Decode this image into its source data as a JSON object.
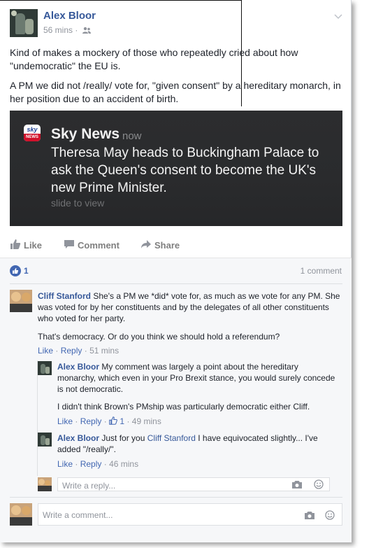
{
  "post": {
    "author": "Alex Bloor",
    "time": "56 mins",
    "audience_icon": "friends-icon",
    "paragraphs": [
      "Kind of makes a mockery of those who repeatedly cried about how \"undemocratic\" the EU is.",
      "A PM we did not /really/ vote for, \"given consent\" by a hereditary monarch, in her position due to an accident of birth."
    ]
  },
  "notification": {
    "logo_top": "sky",
    "logo_bottom": "NEWS",
    "source": "Sky News",
    "time": "now",
    "body": "Theresa May heads to Buckingham Palace to ask the Queen's consent to become the UK's new Prime Minister.",
    "hint": "slide to view"
  },
  "actions": {
    "like": "Like",
    "comment": "Comment",
    "share": "Share"
  },
  "feedback": {
    "like_count": "1",
    "comment_count": "1 comment"
  },
  "comments": [
    {
      "author": "Cliff Stanford",
      "text": "She's a PM we *did* vote for, as much as we vote for any PM. She was voted for by her constituents and by the delegates of all other constituents who voted for her party.",
      "text2": "That's democracy. Or do you think we should hold a referendum?",
      "like": "Like",
      "reply": "Reply",
      "time": "51 mins"
    }
  ],
  "replies": [
    {
      "author": "Alex Bloor",
      "text": "My comment was largely a point about the hereditary monarchy, which even in your Pro Brexit stance, you would surely concede is not democratic.",
      "text2": "I didn't think Brown's PMship was particularly democratic either Cliff.",
      "like": "Like",
      "reply": "Reply",
      "likes": "1",
      "time": "49 mins"
    },
    {
      "author": "Alex Bloor",
      "prefix": "Just for you",
      "mention": "Cliff Stanford",
      "text": "I have equivocated slightly... I've added \"/really/\".",
      "like": "Like",
      "reply": "Reply",
      "time": "46 mins"
    }
  ],
  "reply_input": {
    "placeholder": "Write a reply..."
  },
  "comment_input": {
    "placeholder": "Write a comment..."
  },
  "colors": {
    "link": "#365899",
    "like_blue": "#4267b2",
    "muted": "#90949c"
  }
}
